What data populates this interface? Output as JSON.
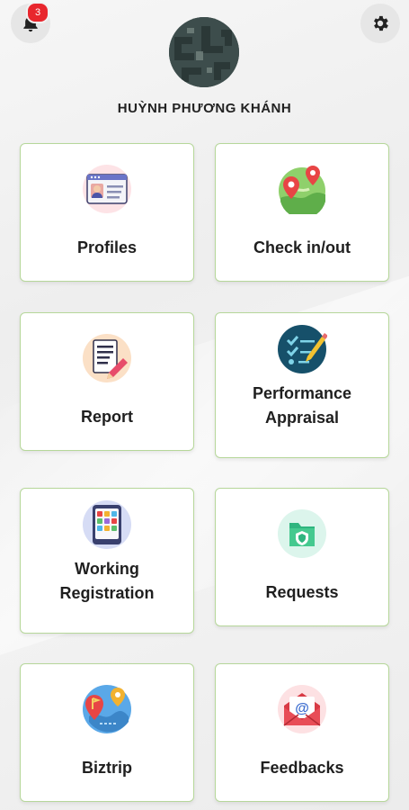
{
  "header": {
    "notification_count": "3",
    "user_name": "HUỲNH PHƯƠNG KHÁNH"
  },
  "menu": [
    {
      "label": "Profiles",
      "icon": "profile-card-icon"
    },
    {
      "label": "Check in/out",
      "icon": "map-pin-icon"
    },
    {
      "label": "Report",
      "icon": "report-document-icon"
    },
    {
      "label": "Performance Appraisal",
      "icon": "appraisal-checklist-icon"
    },
    {
      "label": "Working Registration",
      "icon": "calendar-grid-icon"
    },
    {
      "label": "Requests",
      "icon": "folder-shield-icon"
    },
    {
      "label": "Biztrip",
      "icon": "trip-map-icon"
    },
    {
      "label": "Feedbacks",
      "icon": "mail-at-icon"
    }
  ],
  "colors": {
    "card_border": "#b6d79a",
    "badge": "#e8262d",
    "background": "#f1f1f1"
  }
}
